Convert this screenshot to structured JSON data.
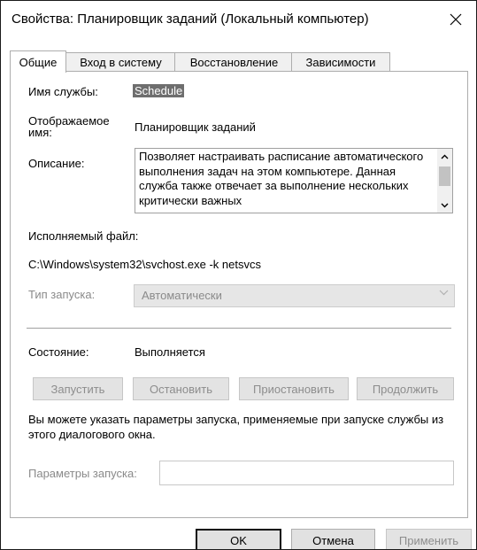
{
  "window": {
    "title": "Свойства: Планировщик заданий (Локальный компьютер)",
    "close_glyph": "✕"
  },
  "tabs": [
    {
      "label": "Общие",
      "active": true
    },
    {
      "label": "Вход в систему",
      "active": false
    },
    {
      "label": "Восстановление",
      "active": false
    },
    {
      "label": "Зависимости",
      "active": false
    }
  ],
  "general": {
    "service_name_label": "Имя службы:",
    "service_name_value": "Schedule",
    "display_name_label_1": "Отображаемое",
    "display_name_label_2": "имя:",
    "display_name_value": "Планировщик заданий",
    "description_label": "Описание:",
    "description_text": "Позволяет настраивать расписание автоматического выполнения задач на этом компьютере. Данная служба также отвечает за выполнение нескольких критически важных",
    "executable_label": "Исполняемый файл:",
    "executable_path": "C:\\Windows\\system32\\svchost.exe -k netsvcs",
    "startup_type_label": "Тип запуска:",
    "startup_type_value": "Автоматически",
    "status_label": "Состояние:",
    "status_value": "Выполняется",
    "buttons": {
      "start": "Запустить",
      "stop": "Остановить",
      "pause": "Приостановить",
      "resume": "Продолжить"
    },
    "hint_text": "Вы можете указать параметры запуска, применяемые при запуске службы из этого диалогового окна.",
    "start_params_label": "Параметры запуска:",
    "start_params_value": ""
  },
  "dialog_buttons": {
    "ok": "OK",
    "cancel": "Отмена",
    "apply": "Применить"
  }
}
